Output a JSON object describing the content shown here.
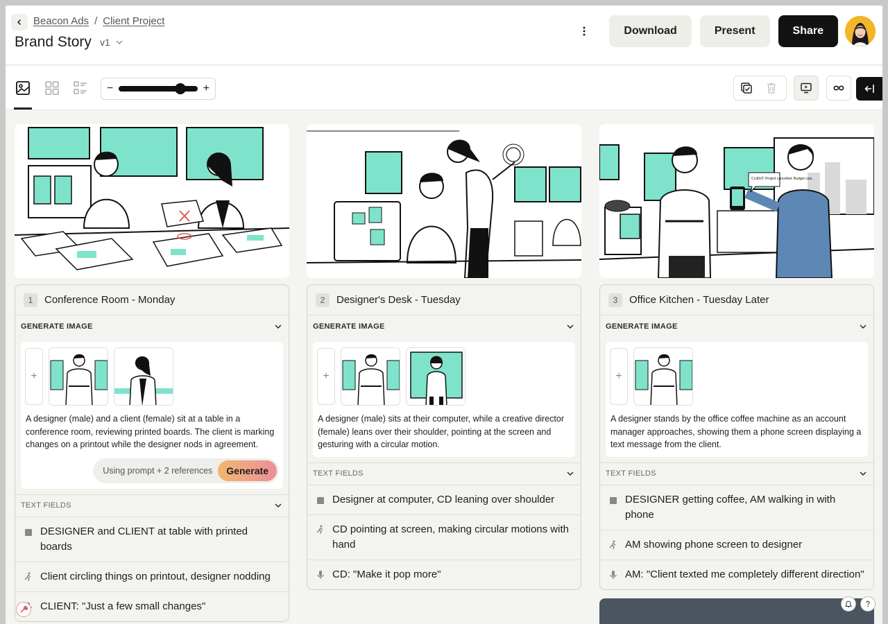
{
  "header": {
    "breadcrumb": [
      "Beacon Ads",
      "Client Project"
    ],
    "separator": "/",
    "title": "Brand Story",
    "version": "v1",
    "download_label": "Download",
    "present_label": "Present",
    "share_label": "Share"
  },
  "toolbar": {
    "zoom_minus": "−",
    "zoom_plus": "+",
    "zoom_level": 0.78
  },
  "labels": {
    "generate_image": "GENERATE IMAGE",
    "text_fields": "TEXT FIELDS",
    "using_prompt": "Using prompt + 2 references",
    "generate": "Generate",
    "add": "+"
  },
  "scenes": [
    {
      "number": "1",
      "title": "Conference Room - Monday",
      "prompt": "A designer (male) and a client (female) sit at a table in a conference room, reviewing printed boards. The client is marking changes on a printout while the designer nods in agreement.",
      "fields": [
        {
          "icon": "scene-icon",
          "text": "DESIGNER and CLIENT at table with printed boards"
        },
        {
          "icon": "action-icon",
          "text": "Client circling things on printout, designer nodding"
        },
        {
          "icon": "dialogue-icon",
          "text": "CLIENT: \"Just a few small changes\""
        }
      ]
    },
    {
      "number": "2",
      "title": "Designer's Desk - Tuesday",
      "prompt": "A designer (male) sits at their computer, while a creative director (female) leans over their shoulder, pointing at the screen and gesturing with a circular motion.",
      "fields": [
        {
          "icon": "scene-icon",
          "text": "Designer at computer, CD leaning over shoulder"
        },
        {
          "icon": "action-icon",
          "text": "CD pointing at screen, making circular motions with hand"
        },
        {
          "icon": "dialogue-icon",
          "text": "CD: \"Make it pop more\""
        }
      ]
    },
    {
      "number": "3",
      "title": "Office Kitchen - Tuesday Later",
      "prompt": "A designer stands by the office coffee machine as an account manager approaches, showing them a phone screen displaying a text message from the client.",
      "phone_text": "CLIENT: Project cancelled. Budget cuts.",
      "fields": [
        {
          "icon": "scene-icon",
          "text": "DESIGNER getting coffee, AM walking in with phone"
        },
        {
          "icon": "action-icon",
          "text": "AM showing phone screen to designer"
        },
        {
          "icon": "dialogue-icon",
          "text": "AM: \"Client texted me completely different direction\""
        }
      ]
    }
  ],
  "colors": {
    "accent_teal": "#7fe3cc",
    "share_bg": "#121212",
    "generate_gradient_start": "#f1b66f",
    "generate_gradient_end": "#ec8f9a"
  }
}
